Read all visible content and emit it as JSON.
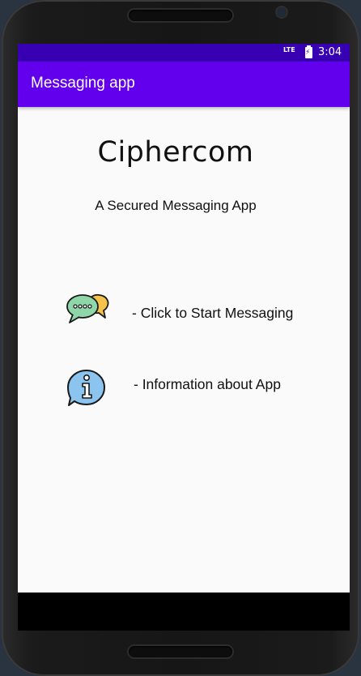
{
  "status_bar": {
    "network": "LTE",
    "time": "3:04"
  },
  "app_bar": {
    "title": "Messaging app"
  },
  "main": {
    "brand": "Ciphercom",
    "tagline": "A Secured Messaging App",
    "actions": [
      {
        "label": "- Click to Start Messaging",
        "icon": "chat-bubbles-icon"
      },
      {
        "label": "- Information about App",
        "icon": "info-icon"
      }
    ]
  },
  "colors": {
    "status_bar": "#3700b3",
    "app_bar": "#6200ee",
    "screen_bg": "#fafafa",
    "chat_bubble_green": "#8fd6a8",
    "chat_bubble_yellow": "#f5c24c",
    "info_blue": "#8cc4f0"
  }
}
